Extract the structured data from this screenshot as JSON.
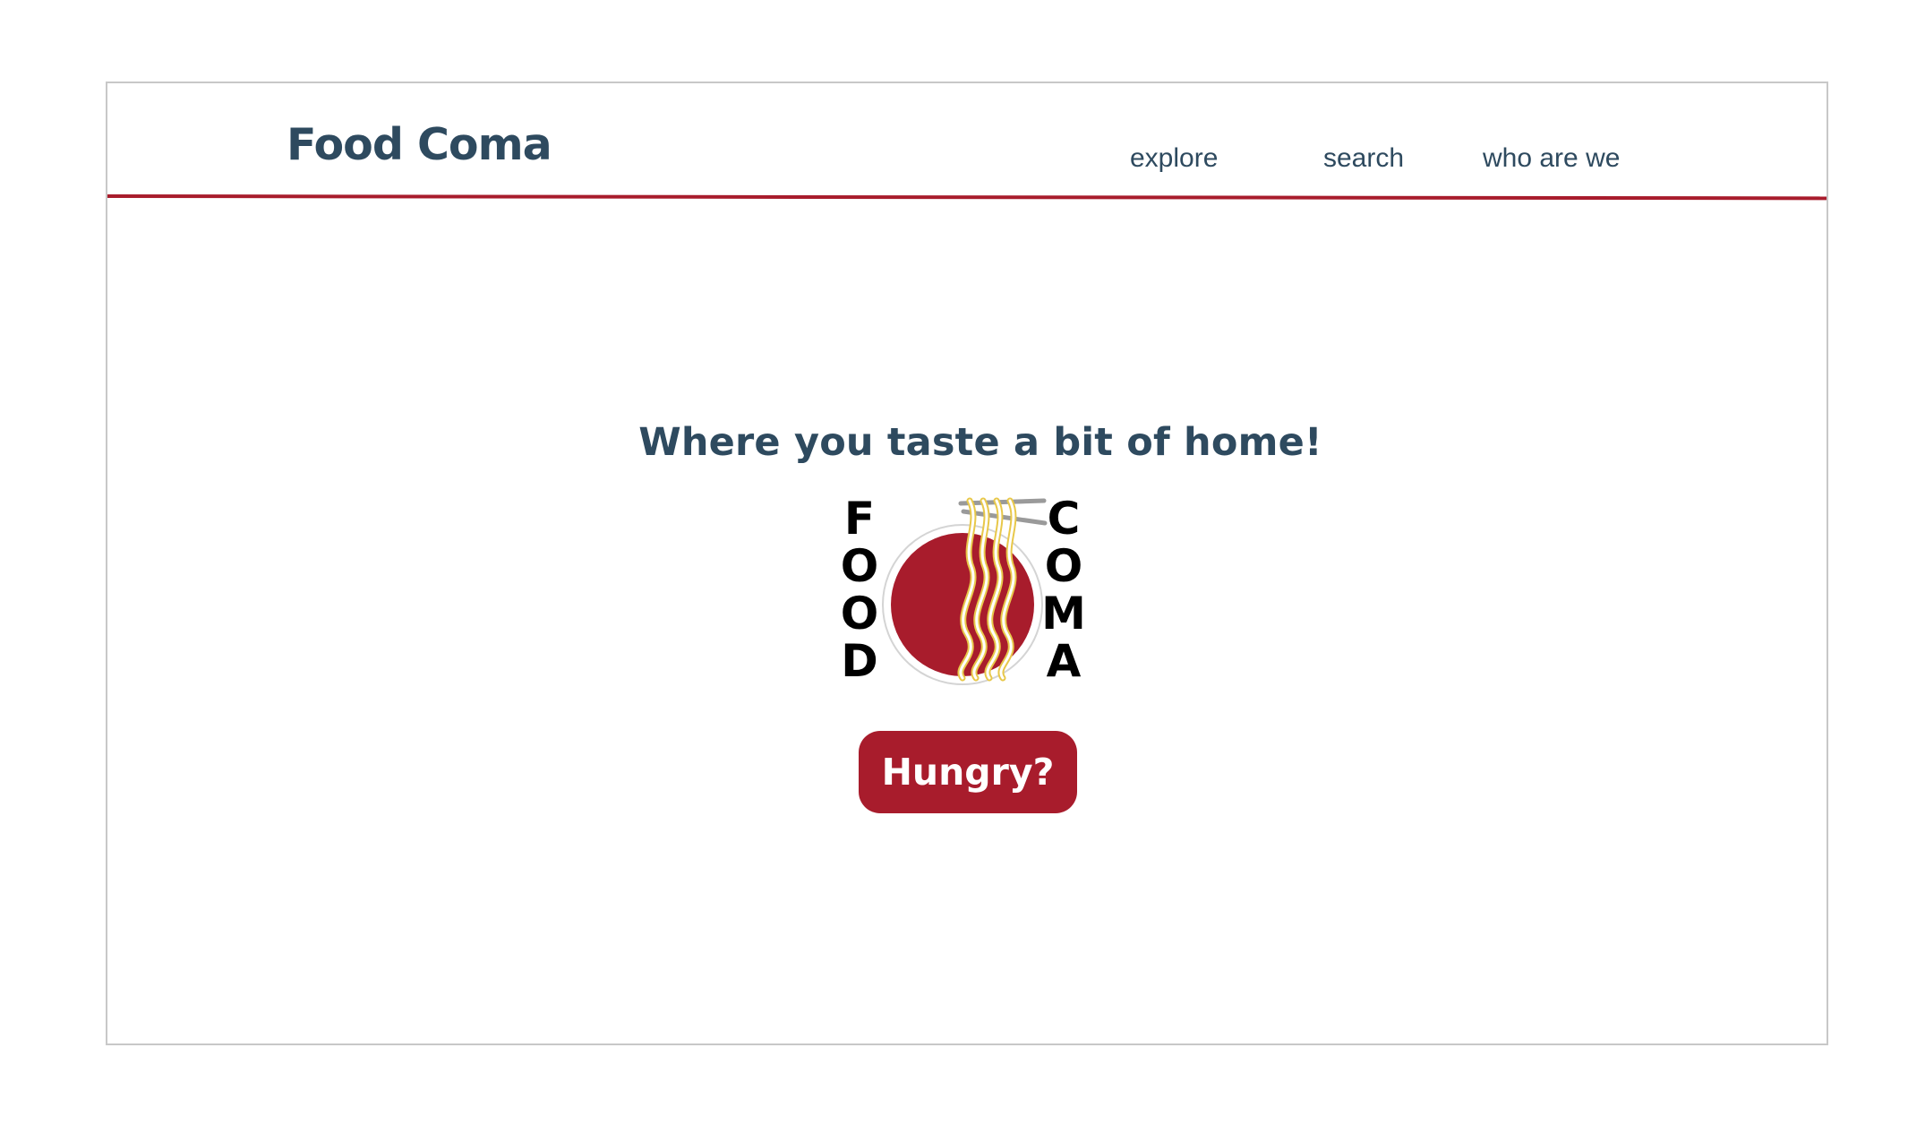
{
  "header": {
    "brand": "Food Coma",
    "nav": [
      {
        "label": "explore"
      },
      {
        "label": "search"
      },
      {
        "label": "who are we"
      }
    ]
  },
  "hero": {
    "tagline": "Where you taste a bit of home!",
    "logo": {
      "left_letters": [
        "F",
        "O",
        "O",
        "D"
      ],
      "right_letters": [
        "C",
        "O",
        "M",
        "A"
      ],
      "icon": "noodle-bowl-chopsticks-icon"
    },
    "cta_label": "Hungry?"
  },
  "colors": {
    "brand_red": "#a81c2c",
    "navy_text": "#2e4a5f",
    "noodle_yellow": "#e8c84a",
    "chopstick_gray": "#9a9a9a"
  }
}
